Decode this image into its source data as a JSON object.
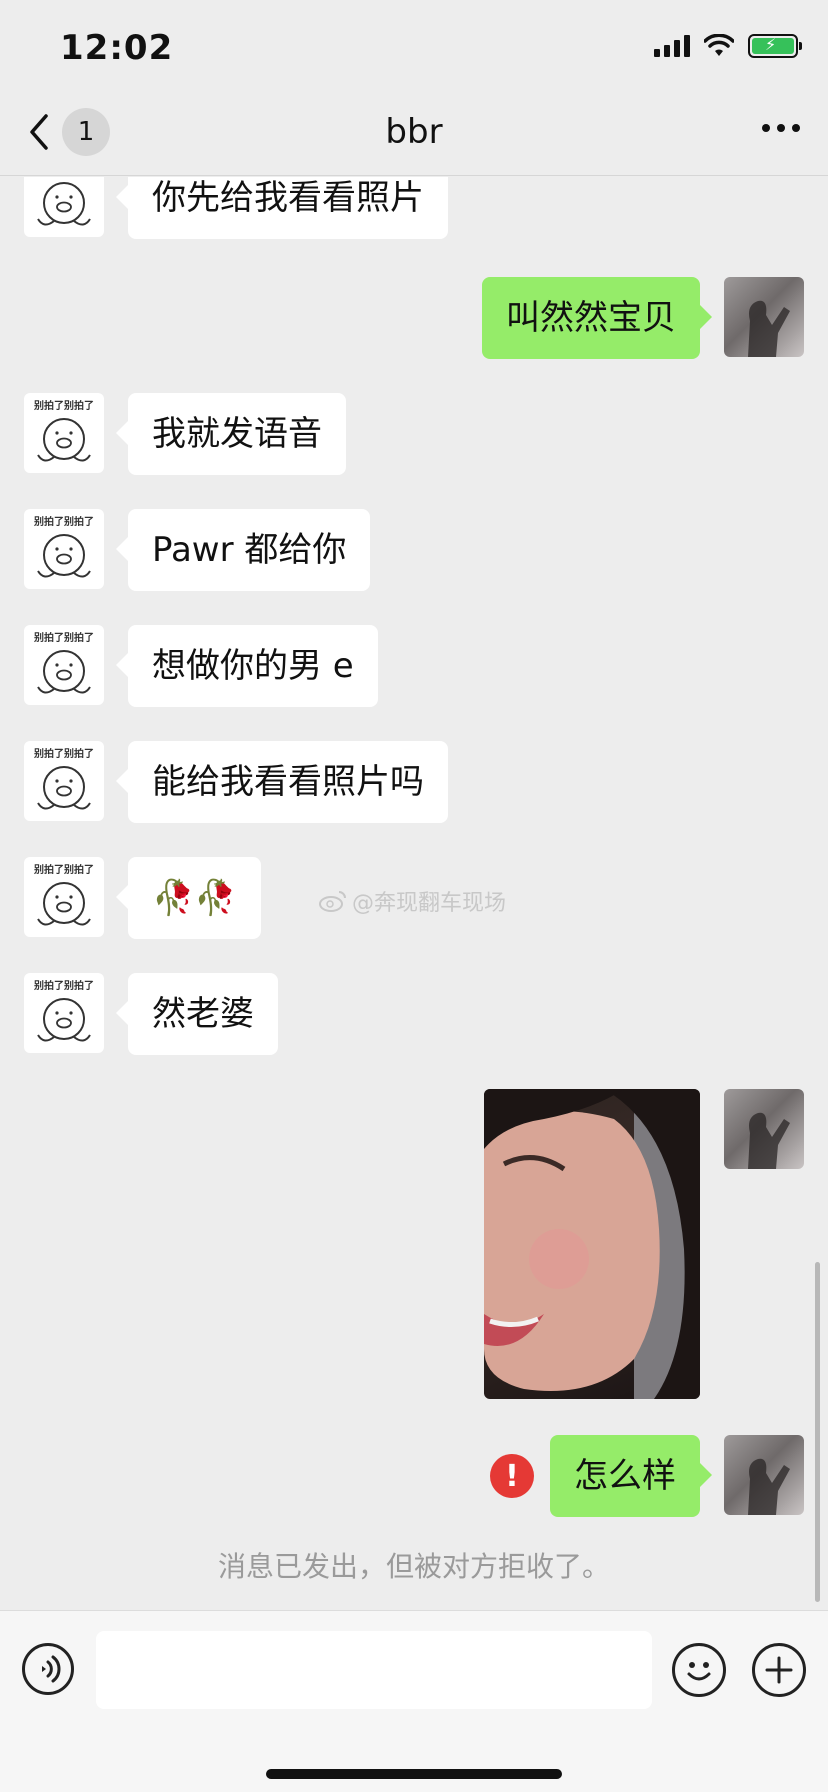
{
  "status_bar": {
    "time": "12:02"
  },
  "nav": {
    "back_badge": "1",
    "title": "bbr"
  },
  "avatar_caption": "别拍了别拍了",
  "messages": {
    "m1": "你先给我看看照片",
    "m2": "叫然然宝贝",
    "m3": "我就发语音",
    "m4": "Pawr 都给你",
    "m5": "想做你的男 e",
    "m6": "能给我看看照片吗",
    "m7": "🥀🥀",
    "m8": "然老婆",
    "m9": "怎么样"
  },
  "error_symbol": "!",
  "system_note": "消息已发出，但被对方拒收了。",
  "watermark": "@奔现翻车现场",
  "input": {
    "value": "",
    "placeholder": ""
  },
  "colors": {
    "bubble_outgoing": "#95ec69",
    "bubble_incoming": "#ffffff",
    "background": "#ededed",
    "error": "#e53935"
  },
  "icons": [
    "back-icon",
    "more-icon",
    "voice-icon",
    "emoji-icon",
    "plus-icon",
    "error-icon",
    "weibo-icon"
  ]
}
